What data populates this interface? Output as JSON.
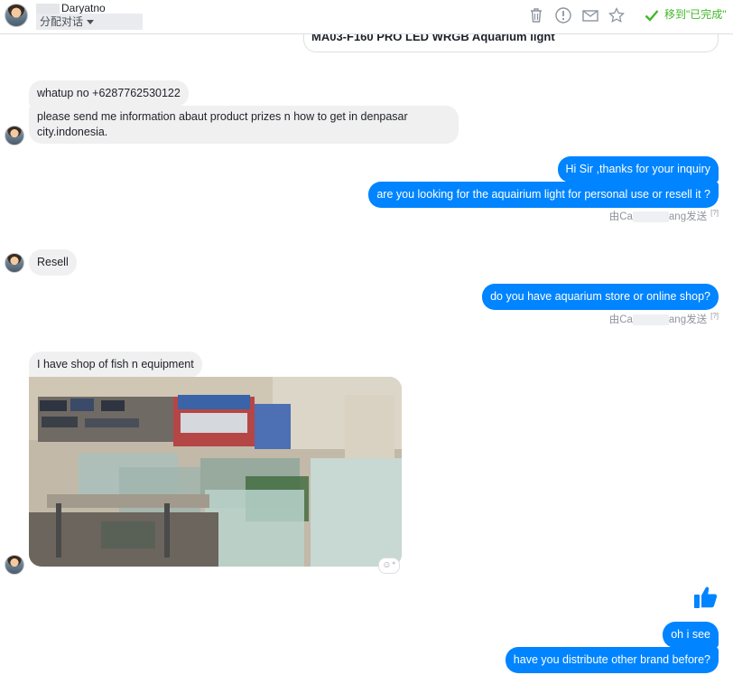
{
  "header": {
    "contact_name": "Daryatno",
    "conversation_label": "分配对话",
    "move_to_done_label": "移到\"已完成\"",
    "icons": [
      "trash-icon",
      "alert-icon",
      "mail-icon",
      "star-icon",
      "checkmark-icon"
    ],
    "accent_color": "#42b72a"
  },
  "thread": {
    "product_card_title": "MA03-F160 PRO LED WRGB Aquarium light",
    "messages": [
      {
        "side": "in",
        "text": "whatup no +6287762530122"
      },
      {
        "side": "in",
        "text": "please send me information abaut product prizes n how to get in denpasar city.indonesia."
      },
      {
        "side": "out",
        "text": "Hi Sir ,thanks for your inquiry"
      },
      {
        "side": "out",
        "text": "are you looking for the aquairium light for personal use or resell it ?"
      },
      {
        "side": "in",
        "text": "Resell"
      },
      {
        "side": "out",
        "text": "do you have aquarium store or online shop?"
      },
      {
        "side": "in",
        "text": "I have shop of fish n equipment"
      },
      {
        "side": "out",
        "text": "oh i see"
      },
      {
        "side": "out",
        "text": "have you distribute other brand before?"
      }
    ],
    "sent_by_prefix": "由Ca",
    "sent_by_suffix": "ang发送",
    "help_mark": "[?]",
    "outgoing_color": "#0084ff",
    "incoming_color": "#f1f0f0"
  }
}
